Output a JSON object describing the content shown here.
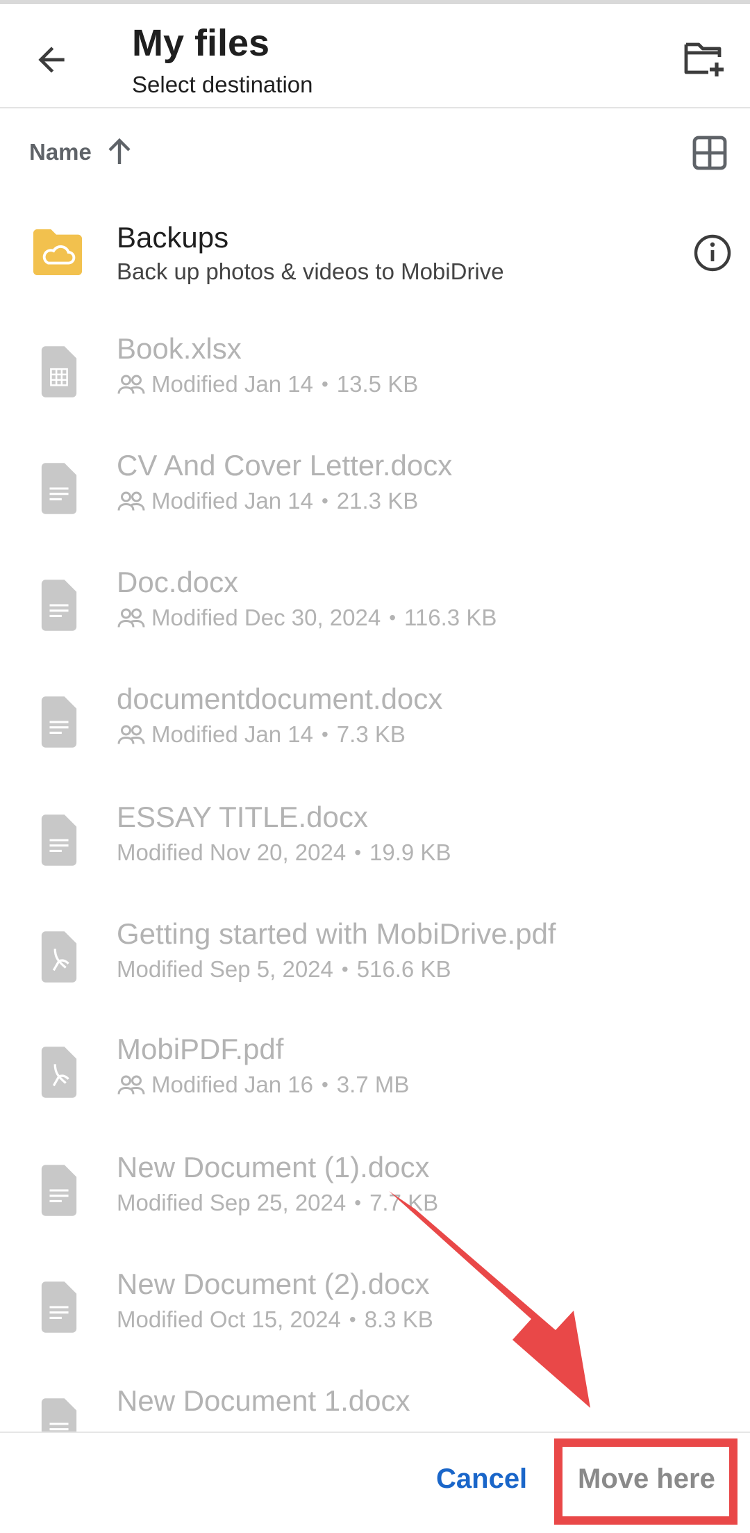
{
  "header": {
    "title": "My files",
    "subtitle": "Select destination",
    "back_icon": "arrow-left-icon",
    "new_folder_icon": "create-new-folder-icon"
  },
  "sort": {
    "label": "Name",
    "direction": "ascending",
    "view_toggle_icon": "grid-view-icon"
  },
  "backups": {
    "name": "Backups",
    "description": "Back up photos & videos to MobiDrive"
  },
  "files": [
    {
      "name": "Book.xlsx",
      "meta": "Modified Jan 14",
      "size": "13.5 KB",
      "shared": true,
      "type": "sheet"
    },
    {
      "name": "CV And Cover Letter.docx",
      "meta": "Modified Jan 14",
      "size": "21.3 KB",
      "shared": true,
      "type": "doc"
    },
    {
      "name": "Doc.docx",
      "meta": "Modified Dec 30, 2024",
      "size": "116.3 KB",
      "shared": true,
      "type": "doc"
    },
    {
      "name": "documentdocument.docx",
      "meta": "Modified Jan 14",
      "size": "7.3 KB",
      "shared": true,
      "type": "doc"
    },
    {
      "name": "ESSAY TITLE.docx",
      "meta": "Modified Nov 20, 2024",
      "size": "19.9 KB",
      "shared": false,
      "type": "doc"
    },
    {
      "name": "Getting started with MobiDrive.pdf",
      "meta": "Modified Sep 5, 2024",
      "size": "516.6 KB",
      "shared": false,
      "type": "pdf"
    },
    {
      "name": "MobiPDF.pdf",
      "meta": "Modified Jan 16",
      "size": "3.7 MB",
      "shared": true,
      "type": "pdf"
    },
    {
      "name": "New Document (1).docx",
      "meta": "Modified Sep 25, 2024",
      "size": "7.7 KB",
      "shared": false,
      "type": "doc"
    },
    {
      "name": "New Document (2).docx",
      "meta": "Modified Oct 15, 2024",
      "size": "8.3 KB",
      "shared": false,
      "type": "doc"
    },
    {
      "name": "New Document 1.docx",
      "meta": "",
      "size": "",
      "shared": false,
      "type": "doc"
    }
  ],
  "actions": {
    "cancel": "Cancel",
    "move_here": "Move here"
  },
  "colors": {
    "accent": "#1a66c9",
    "annotation": "#e94848",
    "folder": "#f2c14e"
  }
}
